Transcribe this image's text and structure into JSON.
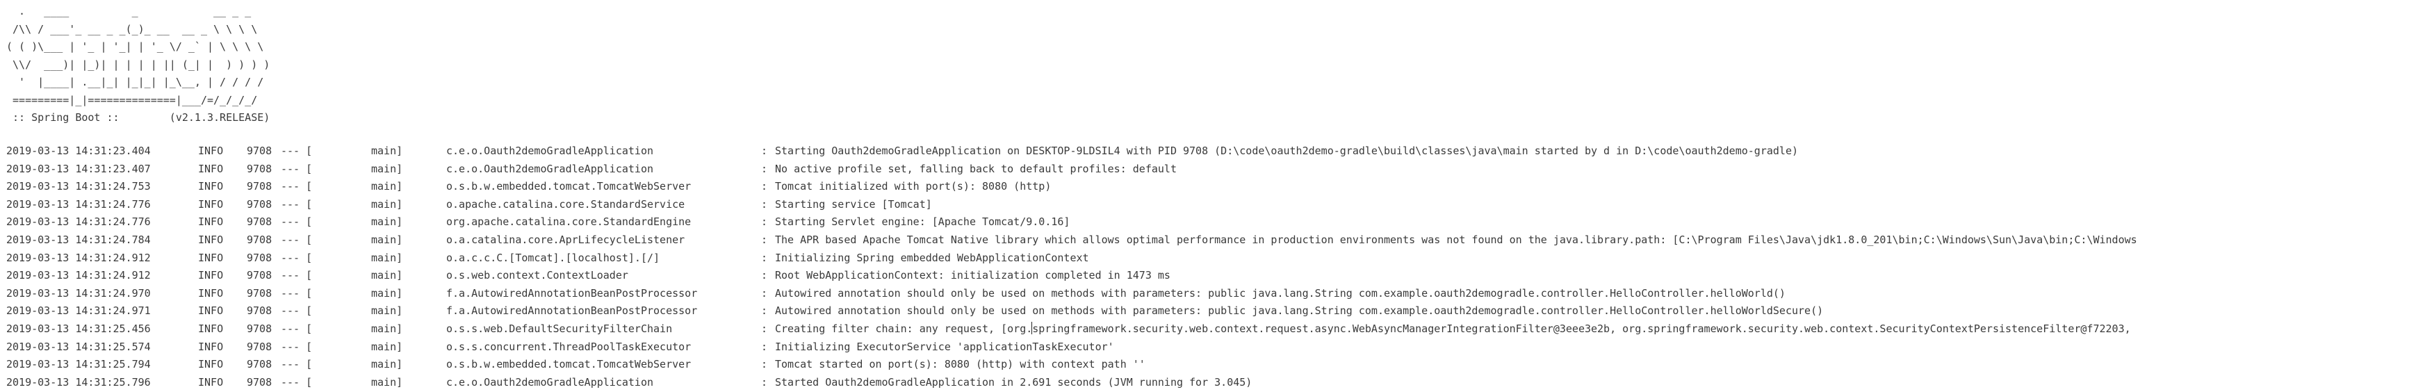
{
  "banner": {
    "lines": [
      "  .   ____          _            __ _ _",
      " /\\\\ / ___'_ __ _ _(_)_ __  __ _ \\ \\ \\ \\",
      "( ( )\\___ | '_ | '_| | '_ \\/ _` | \\ \\ \\ \\",
      " \\\\/  ___)| |_)| | | | | || (_| |  ) ) ) )",
      "  '  |____| .__|_| |_|_| |_\\__, | / / / /",
      " =========|_|==============|___/=/_/_/_/",
      " :: Spring Boot ::        (v2.1.3.RELEASE)"
    ]
  },
  "log": [
    {
      "ts": "2019-03-13 14:31:23.404",
      "level": "INFO",
      "pid": "9708",
      "sep": "--- [",
      "thread": "main]",
      "logger": "c.e.o.Oauth2demoGradleApplication",
      "msg": "Starting Oauth2demoGradleApplication on DESKTOP-9LDSIL4 with PID 9708 (D:\\code\\oauth2demo-gradle\\build\\classes\\java\\main started by d in D:\\code\\oauth2demo-gradle)"
    },
    {
      "ts": "2019-03-13 14:31:23.407",
      "level": "INFO",
      "pid": "9708",
      "sep": "--- [",
      "thread": "main]",
      "logger": "c.e.o.Oauth2demoGradleApplication",
      "msg": "No active profile set, falling back to default profiles: default"
    },
    {
      "ts": "2019-03-13 14:31:24.753",
      "level": "INFO",
      "pid": "9708",
      "sep": "--- [",
      "thread": "main]",
      "logger": "o.s.b.w.embedded.tomcat.TomcatWebServer",
      "msg": "Tomcat initialized with port(s): 8080 (http)"
    },
    {
      "ts": "2019-03-13 14:31:24.776",
      "level": "INFO",
      "pid": "9708",
      "sep": "--- [",
      "thread": "main]",
      "logger": "o.apache.catalina.core.StandardService",
      "msg": "Starting service [Tomcat]"
    },
    {
      "ts": "2019-03-13 14:31:24.776",
      "level": "INFO",
      "pid": "9708",
      "sep": "--- [",
      "thread": "main]",
      "logger": "org.apache.catalina.core.StandardEngine",
      "msg": "Starting Servlet engine: [Apache Tomcat/9.0.16]"
    },
    {
      "ts": "2019-03-13 14:31:24.784",
      "level": "INFO",
      "pid": "9708",
      "sep": "--- [",
      "thread": "main]",
      "logger": "o.a.catalina.core.AprLifecycleListener",
      "msg": "The APR based Apache Tomcat Native library which allows optimal performance in production environments was not found on the java.library.path: [C:\\Program Files\\Java\\jdk1.8.0_201\\bin;C:\\Windows\\Sun\\Java\\bin;C:\\Windows"
    },
    {
      "ts": "2019-03-13 14:31:24.912",
      "level": "INFO",
      "pid": "9708",
      "sep": "--- [",
      "thread": "main]",
      "logger": "o.a.c.c.C.[Tomcat].[localhost].[/]",
      "msg": "Initializing Spring embedded WebApplicationContext"
    },
    {
      "ts": "2019-03-13 14:31:24.912",
      "level": "INFO",
      "pid": "9708",
      "sep": "--- [",
      "thread": "main]",
      "logger": "o.s.web.context.ContextLoader",
      "msg": "Root WebApplicationContext: initialization completed in 1473 ms"
    },
    {
      "ts": "2019-03-13 14:31:24.970",
      "level": "INFO",
      "pid": "9708",
      "sep": "--- [",
      "thread": "main]",
      "logger": "f.a.AutowiredAnnotationBeanPostProcessor",
      "msg": "Autowired annotation should only be used on methods with parameters: public java.lang.String com.example.oauth2demogradle.controller.HelloController.helloWorld()"
    },
    {
      "ts": "2019-03-13 14:31:24.971",
      "level": "INFO",
      "pid": "9708",
      "sep": "--- [",
      "thread": "main]",
      "logger": "f.a.AutowiredAnnotationBeanPostProcessor",
      "msg": "Autowired annotation should only be used on methods with parameters: public java.lang.String com.example.oauth2demogradle.controller.HelloController.helloWorldSecure()"
    },
    {
      "ts": "2019-03-13 14:31:25.456",
      "level": "INFO",
      "pid": "9708",
      "sep": "--- [",
      "thread": "main]",
      "logger": "o.s.s.web.DefaultSecurityFilterChain",
      "msg": "Creating filter chain: any request, [org.springframework.security.web.context.request.async.WebAsyncManagerIntegrationFilter@3eee3e2b, org.springframework.security.web.context.SecurityContextPersistenceFilter@f72203,"
    },
    {
      "ts": "2019-03-13 14:31:25.574",
      "level": "INFO",
      "pid": "9708",
      "sep": "--- [",
      "thread": "main]",
      "logger": "o.s.s.concurrent.ThreadPoolTaskExecutor",
      "msg": "Initializing ExecutorService 'applicationTaskExecutor'"
    },
    {
      "ts": "2019-03-13 14:31:25.794",
      "level": "INFO",
      "pid": "9708",
      "sep": "--- [",
      "thread": "main]",
      "logger": "o.s.b.w.embedded.tomcat.TomcatWebServer",
      "msg": "Tomcat started on port(s): 8080 (http) with context path ''"
    },
    {
      "ts": "2019-03-13 14:31:25.796",
      "level": "INFO",
      "pid": "9708",
      "sep": "--- [",
      "thread": "main]",
      "logger": "c.e.o.Oauth2demoGradleApplication",
      "msg": "Started Oauth2demoGradleApplication in 2.691 seconds (JVM running for 3.045)"
    }
  ]
}
